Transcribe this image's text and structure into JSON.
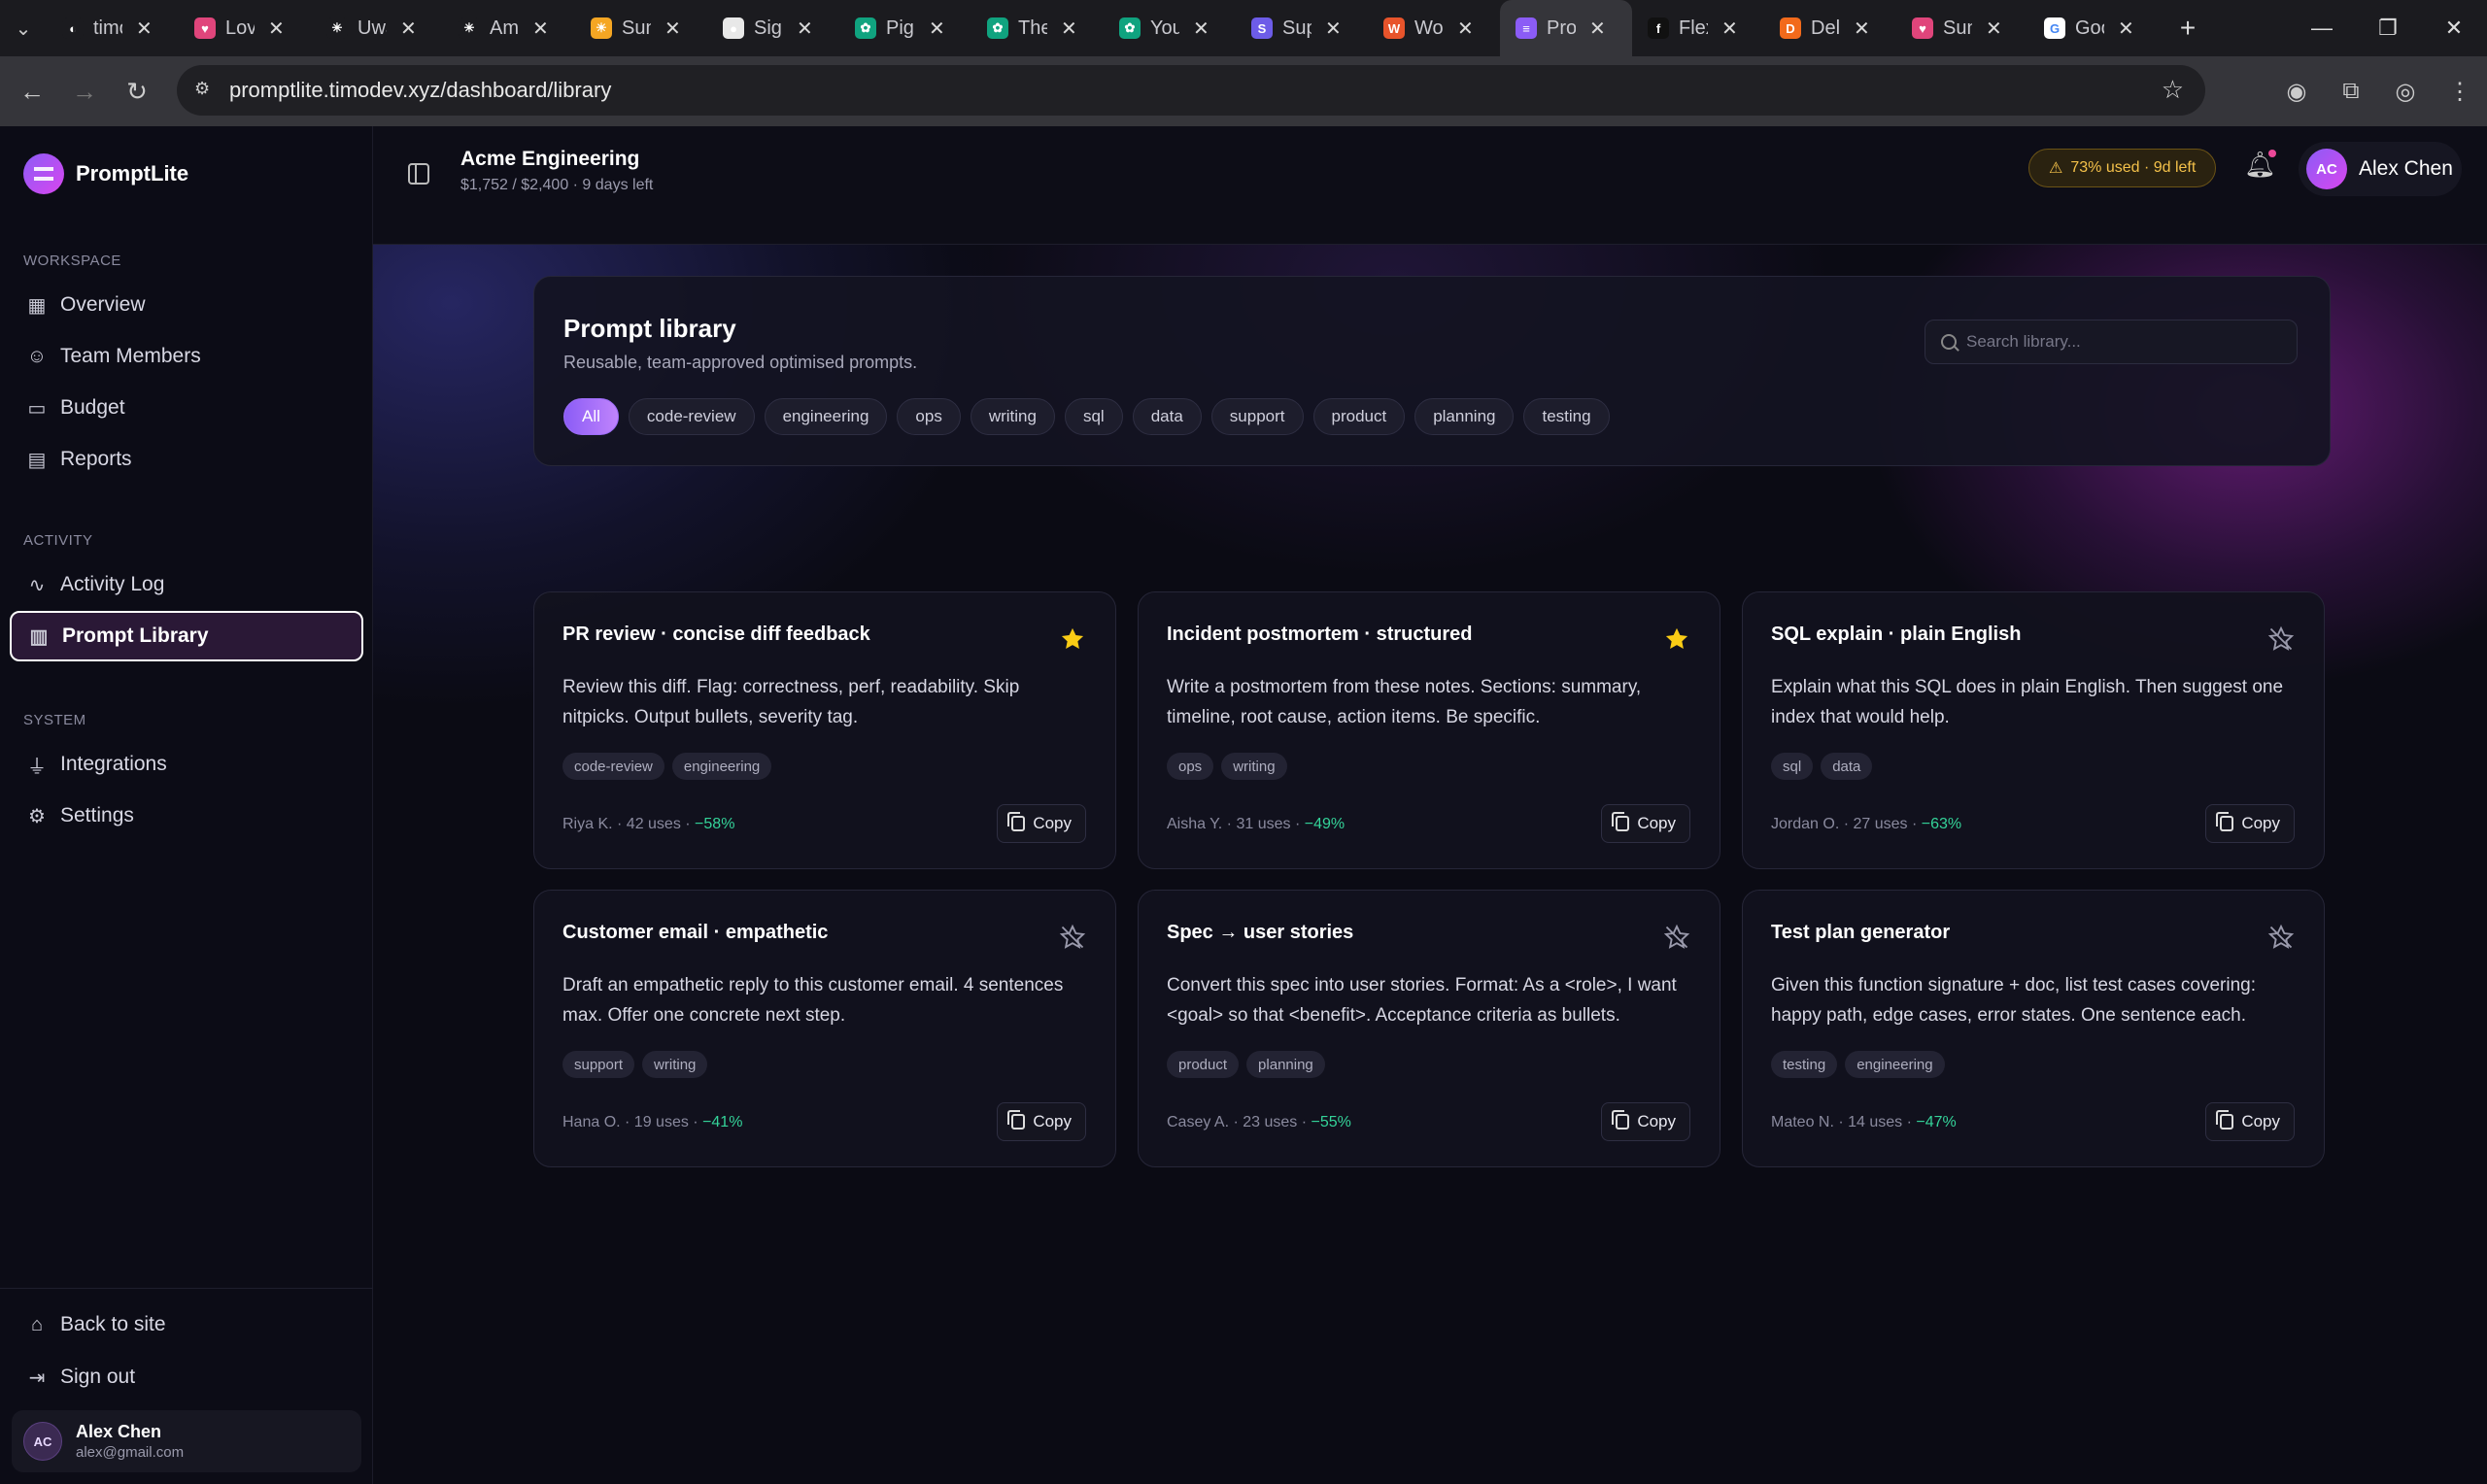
{
  "browser": {
    "tabs": [
      {
        "title": "timo",
        "fav_color": "#1b1b1f",
        "fav_glyph": "◐"
      },
      {
        "title": "Lovable",
        "fav_color": "#e0457b",
        "fav_glyph": "♥"
      },
      {
        "title": "Uwa",
        "fav_color": "#1b1b1f",
        "fav_glyph": "✳"
      },
      {
        "title": "Ami",
        "fav_color": "#1b1b1f",
        "fav_glyph": "✳"
      },
      {
        "title": "Sun",
        "fav_color": "#f5a623",
        "fav_glyph": "☀"
      },
      {
        "title": "Sign",
        "fav_color": "#e8e8e8",
        "fav_glyph": "●"
      },
      {
        "title": "Pig",
        "fav_color": "#10a37f",
        "fav_glyph": "✿"
      },
      {
        "title": "The",
        "fav_color": "#10a37f",
        "fav_glyph": "✿"
      },
      {
        "title": "You",
        "fav_color": "#10a37f",
        "fav_glyph": "✿"
      },
      {
        "title": "Sup",
        "fav_color": "#6d5ce8",
        "fav_glyph": "S"
      },
      {
        "title": "Wo",
        "fav_color": "#e8542b",
        "fav_glyph": "W"
      },
      {
        "title": "Pro",
        "fav_color": "#8b5cf6",
        "fav_glyph": "≡",
        "active": true
      },
      {
        "title": "Flex",
        "fav_color": "#111111",
        "fav_glyph": "f"
      },
      {
        "title": "Del",
        "fav_color": "#f26a1b",
        "fav_glyph": "D"
      },
      {
        "title": "Sun",
        "fav_color": "#e0457b",
        "fav_glyph": "♥"
      },
      {
        "title": "Goo",
        "fav_color": "#ffffff",
        "fav_glyph": "G"
      }
    ],
    "url": "promptlite.timodev.xyz/dashboard/library"
  },
  "sidebar": {
    "brand": "PromptLite",
    "sections": [
      {
        "label": "WORKSPACE",
        "items": [
          {
            "label": "Overview",
            "icon": "grid-icon"
          },
          {
            "label": "Team Members",
            "icon": "users-icon"
          },
          {
            "label": "Budget",
            "icon": "wallet-icon"
          },
          {
            "label": "Reports",
            "icon": "file-icon"
          }
        ]
      },
      {
        "label": "ACTIVITY",
        "items": [
          {
            "label": "Activity Log",
            "icon": "activity-icon"
          },
          {
            "label": "Prompt Library",
            "icon": "book-icon",
            "active": true
          }
        ]
      },
      {
        "label": "SYSTEM",
        "items": [
          {
            "label": "Integrations",
            "icon": "plug-icon"
          },
          {
            "label": "Settings",
            "icon": "gear-icon"
          }
        ]
      }
    ],
    "footer": {
      "back": "Back to site",
      "signout": "Sign out"
    },
    "user": {
      "initials": "AC",
      "name": "Alex Chen",
      "email": "alex@gmail.com"
    }
  },
  "topbar": {
    "org_name": "Acme Engineering",
    "org_sub": "$1,752 / $2,400 · 9 days left",
    "usage": "73% used · 9d left",
    "user_initials": "AC",
    "user_name": "Alex Chen"
  },
  "library": {
    "title": "Prompt library",
    "subtitle": "Reusable, team-approved optimised prompts.",
    "search_placeholder": "Search library...",
    "filters": [
      "All",
      "code-review",
      "engineering",
      "ops",
      "writing",
      "sql",
      "data",
      "support",
      "product",
      "planning",
      "testing"
    ],
    "copy_label": "Copy",
    "cards": [
      {
        "title": "PR review · concise diff feedback",
        "starred": true,
        "body": "Review this diff. Flag: correctness, perf, readability. Skip nitpicks. Output bullets, severity tag.",
        "tags": [
          "code-review",
          "engineering"
        ],
        "meta": "Riya K. · 42 uses · ",
        "saving": "−58%"
      },
      {
        "title": "Incident postmortem · structured",
        "starred": true,
        "body": "Write a postmortem from these notes. Sections: summary, timeline, root cause, action items. Be specific.",
        "tags": [
          "ops",
          "writing"
        ],
        "meta": "Aisha Y. · 31 uses · ",
        "saving": "−49%"
      },
      {
        "title": "SQL explain · plain English",
        "starred": false,
        "body": "Explain what this SQL does in plain English. Then suggest one index that would help.",
        "tags": [
          "sql",
          "data"
        ],
        "meta": "Jordan O. · 27 uses · ",
        "saving": "−63%"
      },
      {
        "title": "Customer email · empathetic",
        "starred": false,
        "body": "Draft an empathetic reply to this customer email. 4 sentences max. Offer one concrete next step.",
        "tags": [
          "support",
          "writing"
        ],
        "meta": "Hana O. · 19 uses · ",
        "saving": "−41%"
      },
      {
        "title": "Spec → user stories",
        "starred": false,
        "body": "Convert this spec into user stories. Format: As a <role>, I want <goal> so that <benefit>. Acceptance criteria as bullets.",
        "tags": [
          "product",
          "planning"
        ],
        "meta": "Casey A. · 23 uses · ",
        "saving": "−55%"
      },
      {
        "title": "Test plan generator",
        "starred": false,
        "body": "Given this function signature + doc, list test cases covering: happy path, edge cases, error states. One sentence each.",
        "tags": [
          "testing",
          "engineering"
        ],
        "meta": "Mateo N. · 14 uses · ",
        "saving": "−47%"
      }
    ]
  }
}
